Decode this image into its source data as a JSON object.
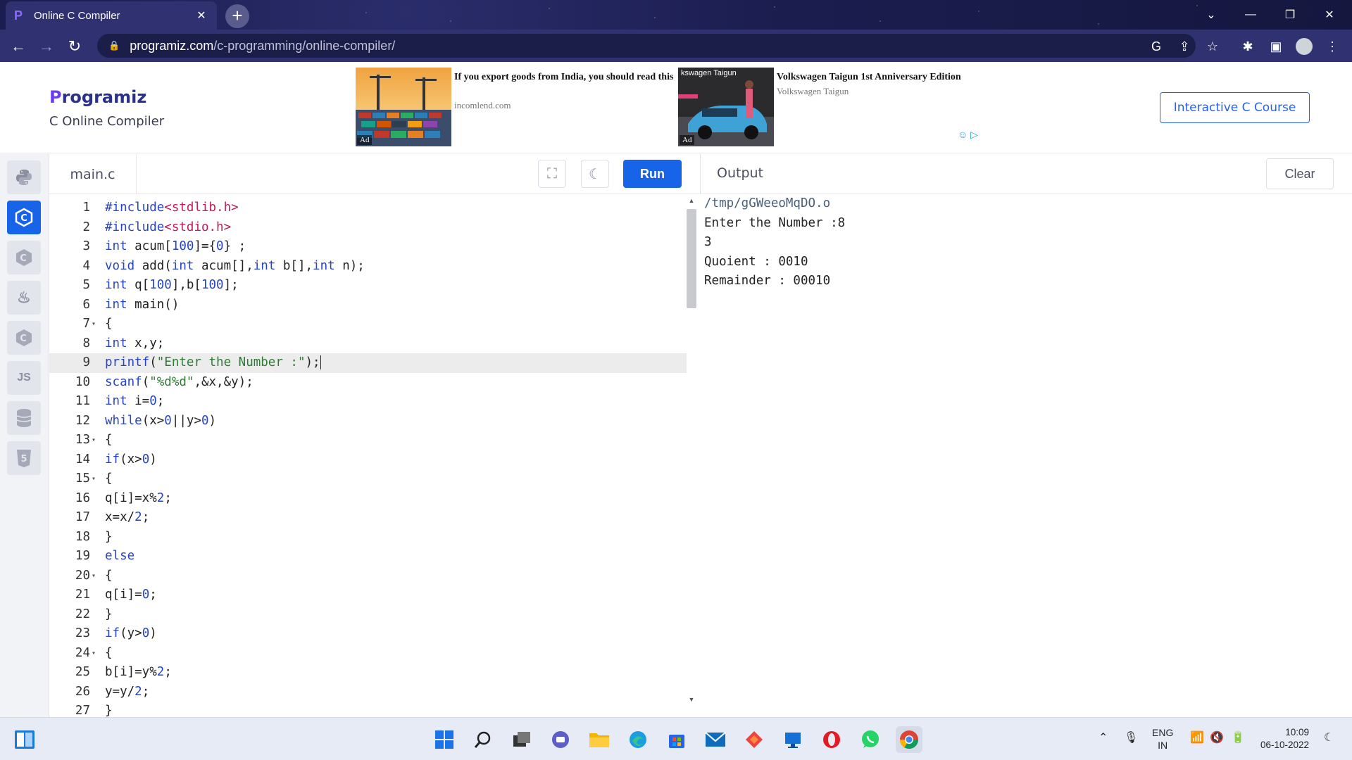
{
  "browser": {
    "tab_title": "Online C Compiler",
    "url_host": "programiz.com",
    "url_path": "/c-programming/online-compiler/"
  },
  "site": {
    "logo_text": "rogramiz",
    "logo_first": "P",
    "subtitle": "C Online Compiler",
    "course_button": "Interactive C Course"
  },
  "ads": [
    {
      "title": "If you export goods from India, you should read this",
      "source": "incomlend.com",
      "tag": "Ad"
    },
    {
      "title": "Volkswagen Taigun 1st Anniversary Edition",
      "source": "Volkswagen Taigun",
      "tag": "Ad",
      "image_caption": "kswagen Taigun"
    }
  ],
  "languages": [
    {
      "name": "python-icon",
      "label": ""
    },
    {
      "name": "c-icon",
      "label": "C",
      "active": true
    },
    {
      "name": "cpp-icon",
      "label": "C"
    },
    {
      "name": "java-icon",
      "label": "♨"
    },
    {
      "name": "csharp-icon",
      "label": "C"
    },
    {
      "name": "js-icon",
      "label": "JS"
    },
    {
      "name": "sql-icon",
      "label": ""
    },
    {
      "name": "html-icon",
      "label": "5"
    }
  ],
  "editor": {
    "file_name": "main.c",
    "run_label": "Run",
    "highlighted_line": 9,
    "lines": [
      "#include<stdlib.h>",
      "#include<stdio.h>",
      "int acum[100]={0} ;",
      "void add(int acum[],int b[],int n);",
      "int q[100],b[100];",
      "int main()",
      "{",
      "int x,y;",
      "printf(\"Enter the Number :\");",
      "scanf(\"%d%d\",&x,&y);",
      "int i=0;",
      "while(x>0||y>0)",
      "{",
      "if(x>0)",
      "{",
      "q[i]=x%2;",
      "x=x/2;",
      "}",
      "else",
      "{",
      "q[i]=0;",
      "}",
      "if(y>0)",
      "{",
      "b[i]=y%2;",
      "y=y/2;",
      "}"
    ],
    "fold_lines": [
      7,
      13,
      15,
      20,
      24
    ]
  },
  "output": {
    "title": "Output",
    "clear_label": "Clear",
    "lines": [
      "/tmp/gGWeeoMqDO.o",
      "Enter the Number :8",
      "3",
      "Quoient : 0010",
      "Remainder : 00010"
    ]
  },
  "taskbar": {
    "lang_top": "ENG",
    "lang_bottom": "IN",
    "time": "10:09",
    "date": "06-10-2022"
  },
  "colors": {
    "accent": "#1764e8",
    "chrome_bg": "#2f3170"
  }
}
